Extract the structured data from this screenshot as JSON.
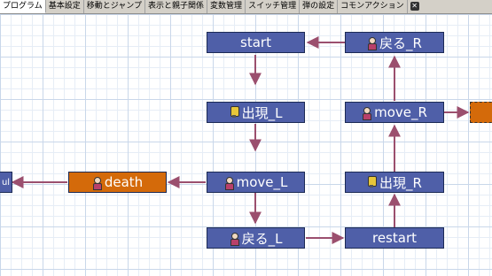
{
  "tabs": [
    {
      "label": "プログラム",
      "active": true
    },
    {
      "label": "基本設定",
      "active": false
    },
    {
      "label": "移動とジャンプ",
      "active": false
    },
    {
      "label": "表示と親子関係",
      "active": false
    },
    {
      "label": "変数管理",
      "active": false
    },
    {
      "label": "スイッチ管理",
      "active": false
    },
    {
      "label": "弾の設定",
      "active": false
    },
    {
      "label": "コモンアクション",
      "active": false
    }
  ],
  "nodes": {
    "start": {
      "label": "start",
      "icon": ""
    },
    "modoru_r": {
      "label": "戻る_R",
      "icon": "person-icon"
    },
    "shutsugen_l": {
      "label": "出現_L",
      "icon": "lamp-icon"
    },
    "move_r": {
      "label": "move_R",
      "icon": "person-icon"
    },
    "death": {
      "label": "death",
      "icon": "person-icon"
    },
    "move_l": {
      "label": "move_L",
      "icon": "person-icon"
    },
    "shutsugen_r": {
      "label": "出現_R",
      "icon": "lamp-icon"
    },
    "modoru_l": {
      "label": "戻る_L",
      "icon": "person-icon"
    },
    "restart": {
      "label": "restart",
      "icon": ""
    },
    "left_partial": {
      "label": "ul",
      "icon": ""
    }
  },
  "colors": {
    "node_blue": "#4f5fa8",
    "node_orange": "#d46a0a",
    "arrow": "#9b4f6e"
  }
}
